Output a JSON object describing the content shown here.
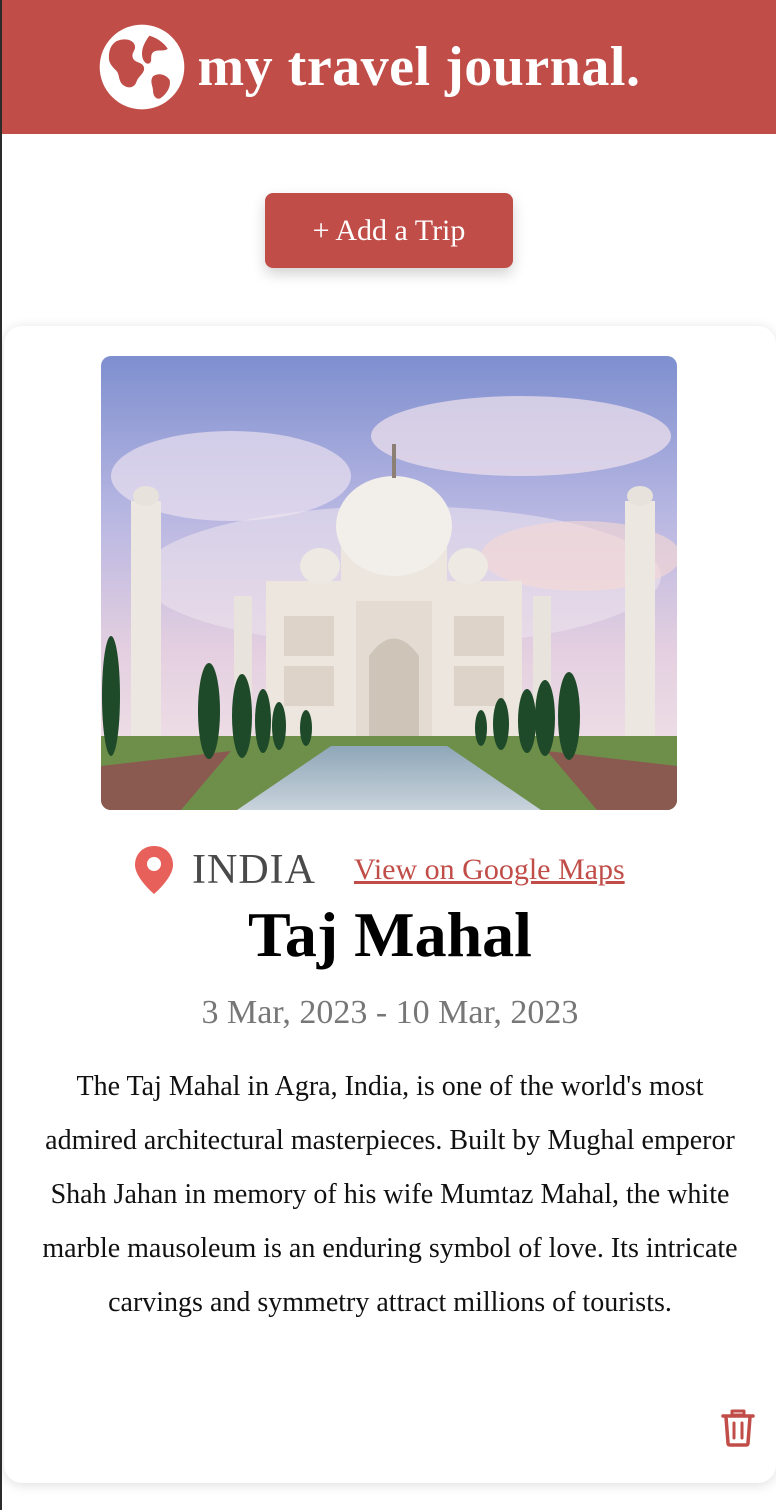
{
  "header": {
    "title": "my travel journal.",
    "logo_icon": "globe-icon",
    "background": "#c14d48"
  },
  "toolbar": {
    "add_trip_label": "+ Add a Trip"
  },
  "entry": {
    "image_icon": "taj-mahal-photo",
    "location_icon": "map-pin-icon",
    "country": "INDIA",
    "maps_link_label": "View on Google Maps",
    "title": "Taj Mahal",
    "dates": "3 Mar, 2023 - 10 Mar, 2023",
    "description": "The Taj Mahal in Agra, India, is one of the world's most admired architectural masterpieces. Built by Mughal emperor Shah Jahan in memory of his wife Mumtaz Mahal, the white marble mausoleum is an enduring symbol of love. Its intricate carvings and symmetry attract millions of tourists.",
    "delete_icon": "trash-icon"
  },
  "colors": {
    "accent": "#c14d48",
    "muted_text": "#777777",
    "country_text": "#4a4a4a"
  }
}
